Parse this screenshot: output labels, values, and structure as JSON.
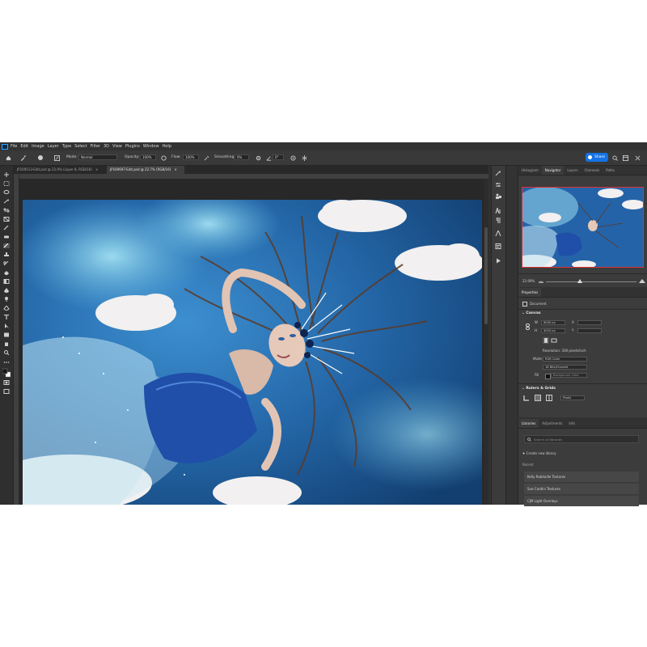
{
  "menubar": {
    "items": [
      "File",
      "Edit",
      "Image",
      "Layer",
      "Type",
      "Select",
      "Filter",
      "3D",
      "View",
      "Plugins",
      "Window",
      "Help"
    ]
  },
  "options": {
    "mode_label": "Mode:",
    "mode_value": "Normal",
    "opacity_label": "Opacity:",
    "opacity_value": "100%",
    "flow_label": "Flow:",
    "flow_value": "100%",
    "smoothing_label": "Smoothing:",
    "smoothing_value": "0%",
    "angle_value": "0°",
    "share_label": "Share"
  },
  "document_tabs": [
    {
      "label": "JP169513-Edit.psd @ 22.9% (Layer 8, RGB/16)",
      "active": false
    },
    {
      "label": "JP169697-Edit.psd @ 22.7% (RGB/16)",
      "active": true
    }
  ],
  "navigator": {
    "tabs": [
      "Histogram",
      "Navigator",
      "Layers",
      "Channels",
      "Paths"
    ],
    "active_tab": "Navigator",
    "zoom_value": "22.69%"
  },
  "properties": {
    "tab": "Properties",
    "document_label": "Document",
    "canvas_title": "Canvas",
    "width_label": "W",
    "width_value": "6000 px",
    "height_label": "H",
    "height_value": "4003 px",
    "x_label": "X",
    "y_label": "Y",
    "resolution": "Resolution: 300 pixels/inch",
    "mode_label": "Mode",
    "mode_value": "RGB Color",
    "depth_value": "16 Bits/Channel",
    "fill_label": "Fill",
    "fill_value": "Background Color",
    "rulers_title": "Rulers & Grids",
    "units_value": "Pixels"
  },
  "libraries": {
    "tabs": [
      "Libraries",
      "Adjustments",
      "Info"
    ],
    "active_tab": "Libraries",
    "search_placeholder": "Search all libraries",
    "create_label": "Create new library",
    "recent_label": "Recent",
    "recent_items": [
      "Kelly Robitaille Textures",
      "Sue Cardini Textures",
      "CJM Light Overlays"
    ]
  },
  "colors": {
    "accent": "#1473e6",
    "app_bg": "#323232",
    "panel_bg": "#3c3c3c"
  },
  "icons": [
    "home-icon",
    "brush-icon",
    "airbrush-icon",
    "settings-icon",
    "search-icon",
    "workspace-icon",
    "minimize-icon",
    "maximize-icon",
    "close-icon"
  ]
}
